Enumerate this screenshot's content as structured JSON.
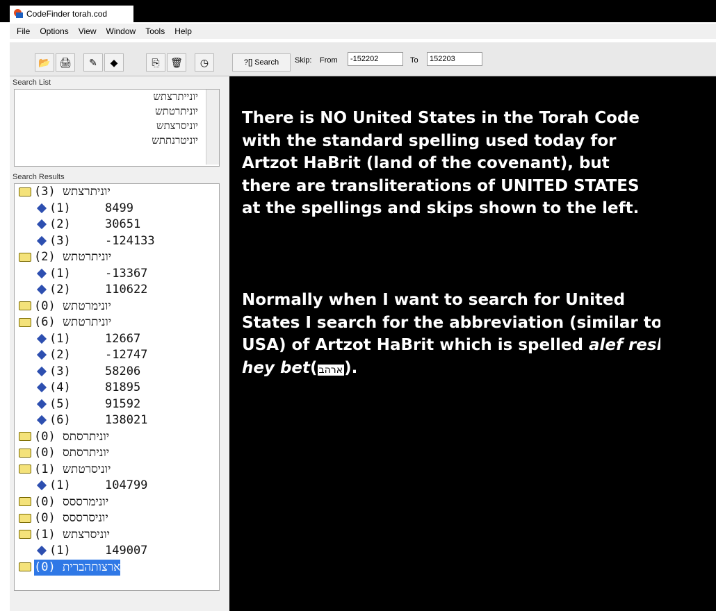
{
  "window": {
    "title": "CodeFinder torah.cod"
  },
  "menu": [
    "File",
    "Options",
    "View",
    "Window",
    "Tools",
    "Help"
  ],
  "toolbar": {
    "search_label": "?[] Search",
    "skip_label": "Skip:",
    "from_label": "From",
    "from_value": "-152202",
    "to_label": "To",
    "to_value": "152203"
  },
  "search_list": {
    "label": "Search List",
    "items": [
      "יונייתרצתש",
      "יוניתרטתש",
      "יוניסרצתש",
      "יוניטרנתתש"
    ]
  },
  "search_results": {
    "label": "Search Results",
    "rows": [
      {
        "kind": "folder",
        "text": "יוניתרצתש (3)"
      },
      {
        "kind": "hit",
        "num": "(1)",
        "skip": "8499"
      },
      {
        "kind": "hit",
        "num": "(2)",
        "skip": "30651"
      },
      {
        "kind": "hit",
        "num": "(3)",
        "skip": "-124133"
      },
      {
        "kind": "folder",
        "text": "יוניתרטתש (2)"
      },
      {
        "kind": "hit",
        "num": "(1)",
        "skip": "-13367"
      },
      {
        "kind": "hit",
        "num": "(2)",
        "skip": "110622"
      },
      {
        "kind": "folder",
        "text": "יונימרטתש (0)"
      },
      {
        "kind": "folder",
        "text": "יוניתרטתש (6)"
      },
      {
        "kind": "hit",
        "num": "(1)",
        "skip": "12667"
      },
      {
        "kind": "hit",
        "num": "(2)",
        "skip": "-12747"
      },
      {
        "kind": "hit",
        "num": "(3)",
        "skip": "58206"
      },
      {
        "kind": "hit",
        "num": "(4)",
        "skip": "81895"
      },
      {
        "kind": "hit",
        "num": "(5)",
        "skip": "91592"
      },
      {
        "kind": "hit",
        "num": "(6)",
        "skip": "138021"
      },
      {
        "kind": "folder",
        "text": "יוניתרסתס (0)"
      },
      {
        "kind": "folder",
        "text": "יוניתרסתס (0)"
      },
      {
        "kind": "folder",
        "text": "יוניסרטתש (1)"
      },
      {
        "kind": "hit",
        "num": "(1)",
        "skip": "104799"
      },
      {
        "kind": "folder",
        "text": "יונימרססס (0)"
      },
      {
        "kind": "folder",
        "text": "יוניסרססס (0)"
      },
      {
        "kind": "folder",
        "text": "יוניסרצתש (1)"
      },
      {
        "kind": "hit",
        "num": "(1)",
        "skip": "149007"
      },
      {
        "kind": "folder",
        "text": "ארצותהברית (0)",
        "selected": true
      }
    ]
  },
  "main_text": {
    "para1": "There is NO United States in the Torah Code with the standard spelling used today for Artzot HaBrit (land of the covenant), but there are transliterations of UNITED STATES at the spellings and skips shown to the left.",
    "para2_start": "Normally when I want to search for United States I search for the abbreviation (similar to USA) of Artzot HaBrit which is spelled ",
    "para2_italic": "alef resh hey bet",
    "para2_paren_open": "(",
    "para2_hebrew": "ארהב",
    "para2_end": ")."
  }
}
